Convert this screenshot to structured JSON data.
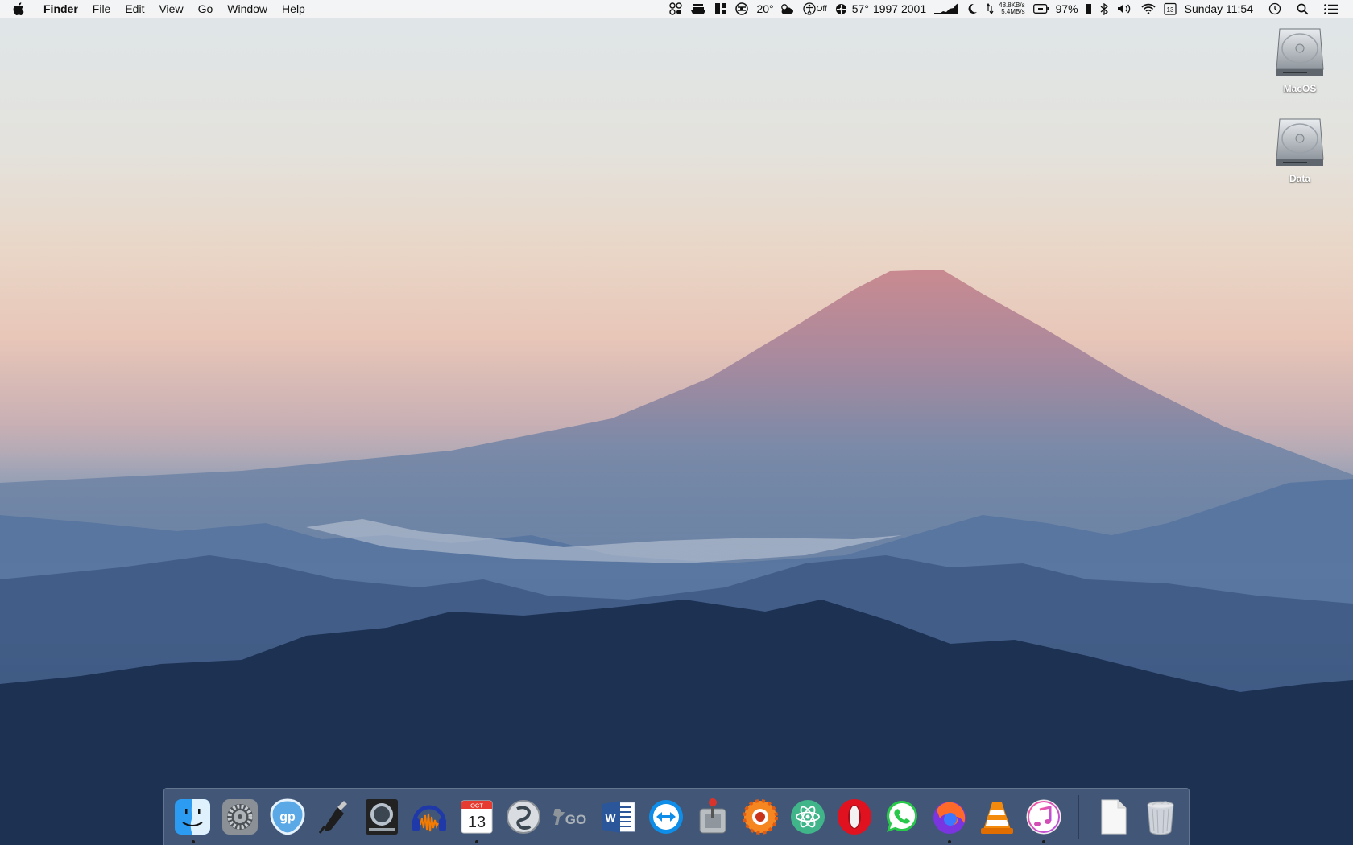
{
  "menubar": {
    "app_name": "Finder",
    "menus": [
      "File",
      "Edit",
      "View",
      "Go",
      "Window",
      "Help"
    ],
    "status": {
      "weather_temp": "20°",
      "caffeine_state": "Off",
      "sensor_temp": "57°",
      "fan_speeds": "1997 2001",
      "net_up": "48.8KB/s",
      "net_down": "5.4MB/s",
      "battery": "97%",
      "calendar_day": "13",
      "clock": "Sunday 11:54"
    }
  },
  "desktop": {
    "icons": [
      {
        "label": "MacOS",
        "icon": "hard-drive-icon"
      },
      {
        "label": "Data",
        "icon": "hard-drive-icon"
      }
    ]
  },
  "dock": {
    "calendar_month": "OCT",
    "calendar_day": "13",
    "csgo_text": "GO",
    "word_letter": "W",
    "apps": [
      {
        "name": "finder",
        "icon": "finder-icon",
        "running": true
      },
      {
        "name": "system-preferences",
        "icon": "gear-icon",
        "running": false
      },
      {
        "name": "guitar-pro",
        "icon": "guitar-pro-icon",
        "running": false
      },
      {
        "name": "audio-jack",
        "icon": "audio-jack-icon",
        "running": false
      },
      {
        "name": "logic-pro",
        "icon": "logic-pro-icon",
        "running": false
      },
      {
        "name": "audacity",
        "icon": "audacity-icon",
        "running": false
      },
      {
        "name": "calendar",
        "icon": "calendar-icon",
        "running": true
      },
      {
        "name": "screenflow",
        "icon": "screenflow-icon",
        "running": false
      },
      {
        "name": "csgo",
        "icon": "csgo-icon",
        "running": false
      },
      {
        "name": "word",
        "icon": "word-icon",
        "running": false
      },
      {
        "name": "teamviewer",
        "icon": "teamviewer-icon",
        "running": false
      },
      {
        "name": "transmission",
        "icon": "transmission-icon",
        "running": false
      },
      {
        "name": "xnview",
        "icon": "xnview-icon",
        "running": false
      },
      {
        "name": "atom",
        "icon": "atom-icon",
        "running": false
      },
      {
        "name": "opera",
        "icon": "opera-icon",
        "running": false
      },
      {
        "name": "whatsapp",
        "icon": "whatsapp-icon",
        "running": false
      },
      {
        "name": "firefox",
        "icon": "firefox-icon",
        "running": true
      },
      {
        "name": "vlc",
        "icon": "vlc-icon",
        "running": false
      },
      {
        "name": "itunes",
        "icon": "itunes-icon",
        "running": true
      }
    ],
    "stack_items": [
      {
        "name": "documents",
        "icon": "document-icon"
      },
      {
        "name": "trash",
        "icon": "trash-icon"
      }
    ]
  }
}
